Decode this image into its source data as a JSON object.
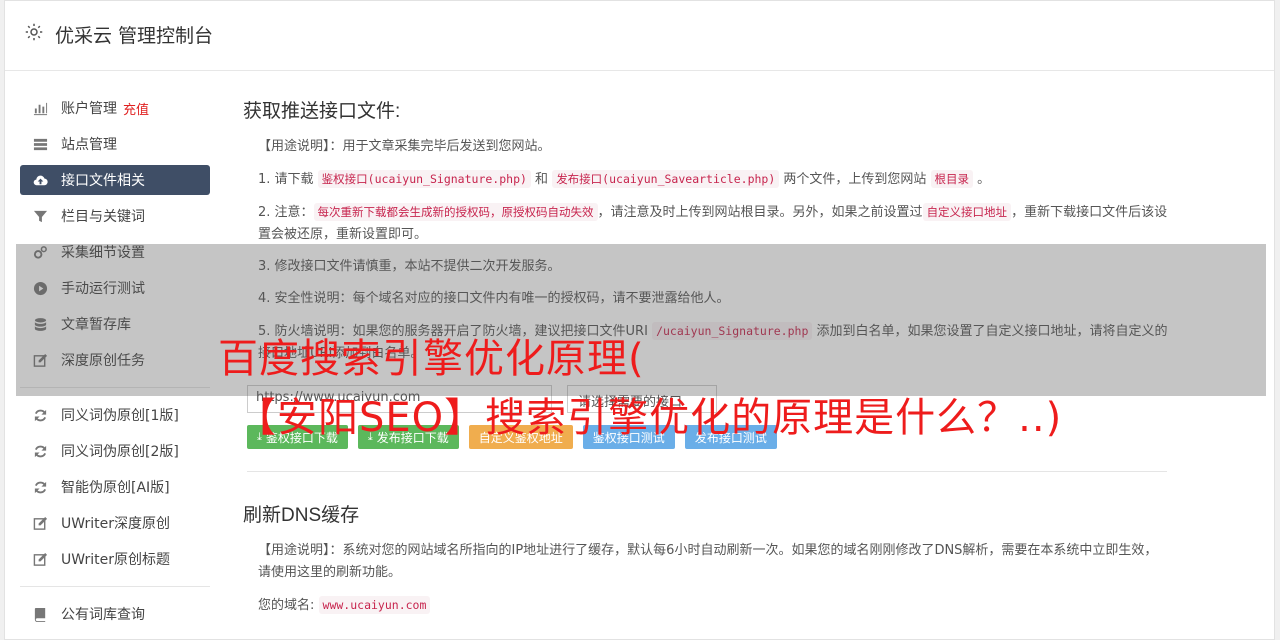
{
  "header": {
    "title": "优采云 管理控制台"
  },
  "sidebar": {
    "group1": [
      {
        "label": "账户管理",
        "extra": "充值",
        "icon": "bar-chart-icon",
        "active": false
      },
      {
        "label": "站点管理",
        "icon": "server-icon",
        "active": false
      },
      {
        "label": "接口文件相关",
        "icon": "cloud-upload-icon",
        "active": true
      },
      {
        "label": "栏目与关键词",
        "icon": "filter-icon",
        "active": false
      },
      {
        "label": "采集细节设置",
        "icon": "cogs-icon",
        "active": false
      },
      {
        "label": "手动运行测试",
        "icon": "play-circle-icon",
        "active": false
      },
      {
        "label": "文章暂存库",
        "icon": "database-icon",
        "active": false
      },
      {
        "label": "深度原创任务",
        "icon": "edit-icon",
        "active": false
      }
    ],
    "group2": [
      {
        "label": "同义词伪原创[1版]",
        "icon": "refresh-icon"
      },
      {
        "label": "同义词伪原创[2版]",
        "icon": "refresh-icon"
      },
      {
        "label": "智能伪原创[AI版]",
        "icon": "refresh-icon"
      },
      {
        "label": "UWriter深度原创",
        "icon": "edit-icon"
      },
      {
        "label": "UWriter原创标题",
        "icon": "edit-icon"
      }
    ],
    "group3": [
      {
        "label": "公有词库查询",
        "icon": "book-icon"
      }
    ]
  },
  "section1": {
    "title": "获取推送接口文件:",
    "usage": "【用途说明】：用于文章采集完毕后发送到您网站。",
    "step1": {
      "a": "1. 请下载 ",
      "code1": "鉴权接口(ucaiyun_Signature.php)",
      "b": " 和 ",
      "code2": "发布接口(ucaiyun_Savearticle.php)",
      "c": " 两个文件，上传到您网站 ",
      "code3": "根目录",
      "d": " 。"
    },
    "step2": {
      "a": "2. 注意：",
      "code1": "每次重新下载都会生成新的授权码，原授权码自动失效",
      "b": "，请注意及时上传到网站根目录。另外，如果之前设置过",
      "code2": "自定义接口地址",
      "c": "，重新下载接口文件后该设置会被还原，重新设置即可。"
    },
    "step3": "3. 修改接口文件请慎重，本站不提供二次开发服务。",
    "step4": "4. 安全性说明：每个域名对应的接口文件内有唯一的授权码，请不要泄露给他人。",
    "step5": {
      "a": "5. 防火墙说明：如果您的服务器开启了防火墙，建议把接口文件URI ",
      "code1": "/ucaiyun_Signature.php",
      "b": " 添加到白名单，如果您设置了自定义接口地址，请将自定义的接口地址URI添加到白名单。"
    },
    "input_value": "https://www.ucaiyun.com",
    "select_value": "请选择需要的接口",
    "buttons": {
      "b1": "鉴权接口下载",
      "b2": "发布接口下载",
      "b3": "自定义鉴权地址",
      "b4": "鉴权接口测试",
      "b5": "发布接口测试"
    }
  },
  "section2": {
    "title": "刷新DNS缓存",
    "usage": "【用途说明】：系统对您的网站域名所指向的IP地址进行了缓存，默认每6小时自动刷新一次。如果您的域名刚刚修改了DNS解析，需要在本系统中立即生效，请使用这里的刷新功能。",
    "domain_label": "您的域名:",
    "domain_value": "www.ucaiyun.com"
  },
  "watermark": {
    "line1": "百度搜索引擎优化原理(",
    "line2": "【安阳SEO】搜索引擎优化的原理是什么？..)"
  },
  "colors": {
    "active_nav": "#3f4e66",
    "watermark": "#ee1c1c",
    "green": "#5cb85c",
    "orange": "#f0ad4e",
    "blue": "#5bc0de"
  }
}
